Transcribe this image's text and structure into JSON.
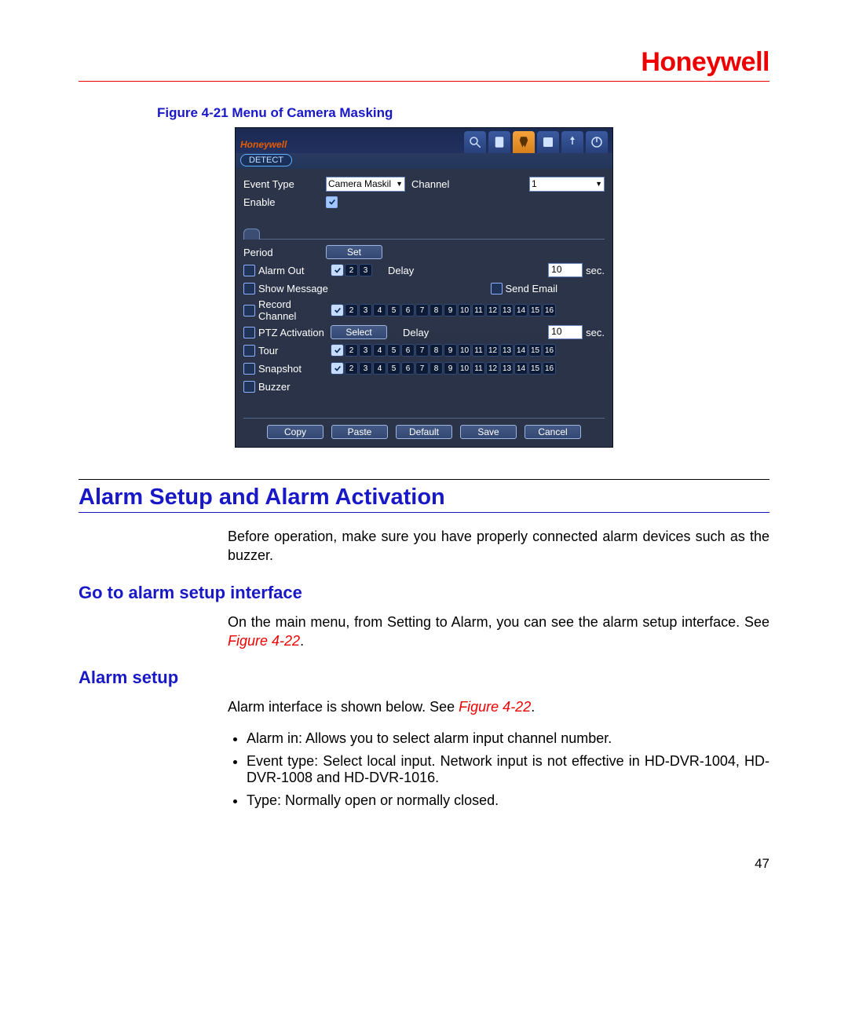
{
  "brand": "Honeywell",
  "figure_caption": "Figure 4-21 Menu of Camera Masking",
  "dvr": {
    "logo": "Honeywell",
    "tab_label": "DETECT",
    "event_type_label": "Event Type",
    "event_type_value": "Camera Maskil",
    "channel_label": "Channel",
    "channel_value": "1",
    "enable_label": "Enable",
    "period_label": "Period",
    "set_btn": "Set",
    "alarm_out_label": "Alarm Out",
    "delay_label": "Delay",
    "delay_value": "10",
    "sec_label": "sec.",
    "show_message_label": "Show Message",
    "send_email_label": "Send Email",
    "record_channel_label": "Record Channel",
    "ptz_label": "PTZ Activation",
    "select_btn": "Select",
    "ptz_delay_value": "10",
    "tour_label": "Tour",
    "snapshot_label": "Snapshot",
    "buzzer_label": "Buzzer",
    "copy_btn": "Copy",
    "paste_btn": "Paste",
    "default_btn": "Default",
    "save_btn": "Save",
    "cancel_btn": "Cancel",
    "alarm_out_channels": [
      "1",
      "2",
      "3"
    ],
    "channels_16": [
      "1",
      "2",
      "3",
      "4",
      "5",
      "6",
      "7",
      "8",
      "9",
      "10",
      "11",
      "12",
      "13",
      "14",
      "15",
      "16"
    ]
  },
  "section_title": "Alarm Setup and Alarm Activation",
  "para_intro": "Before operation, make sure you have properly connected alarm devices such as the buzzer.",
  "sub1_title": "Go to alarm setup interface",
  "sub1_text_a": "On the main menu, from Setting to Alarm, you can see the alarm setup interface. See ",
  "sub1_figref": "Figure 4-22",
  "sub1_text_b": ".",
  "sub2_title": "Alarm setup",
  "sub2_intro_a": "Alarm interface is shown below. See ",
  "sub2_figref": "Figure 4-22",
  "sub2_intro_b": ".",
  "bullets": [
    "Alarm in: Allows you to select alarm input channel number.",
    "Event type: Select local input. Network input is not effective in HD-DVR-1004, HD-DVR-1008 and HD-DVR-1016.",
    "Type: Normally open or normally closed."
  ],
  "page_number": "47"
}
